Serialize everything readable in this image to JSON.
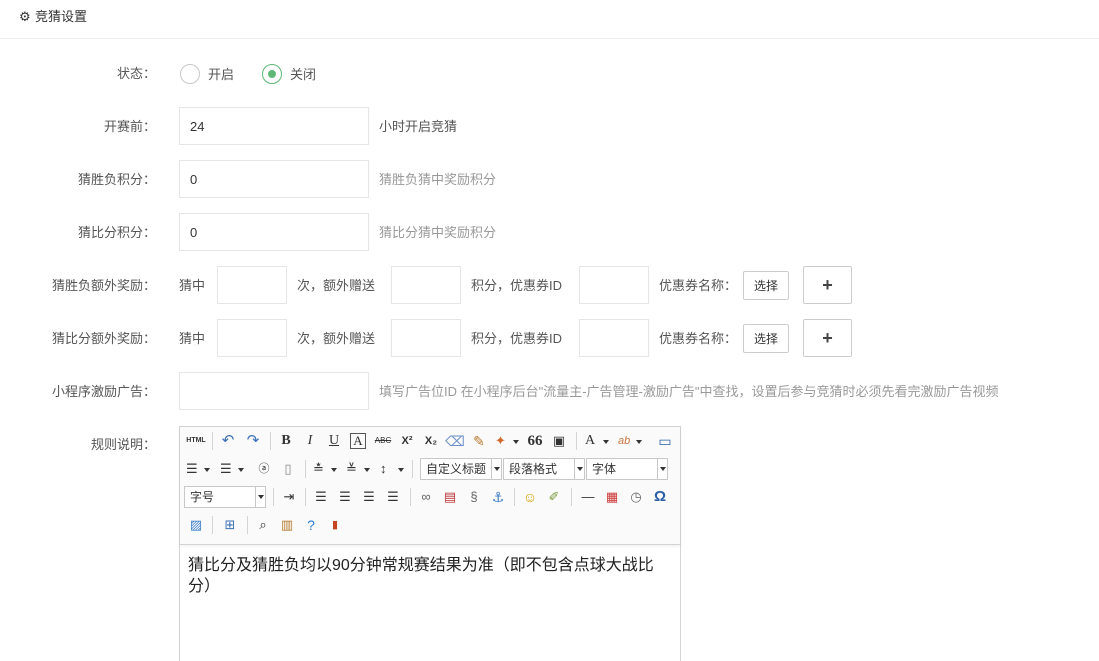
{
  "header": {
    "title": "竞猜设置",
    "icon": "gear-icon"
  },
  "status": {
    "label": "状态：",
    "options": [
      "开启",
      "关闭"
    ],
    "selected": "关闭",
    "accent": "#5fb878"
  },
  "before_match": {
    "label": "开赛前：",
    "value": "24",
    "suffix": "小时开启竞猜"
  },
  "win_lose_points": {
    "label": "猜胜负积分：",
    "value": "0",
    "hint": "猜胜负猜中奖励积分"
  },
  "score_points": {
    "label": "猜比分积分：",
    "value": "0",
    "hint": "猜比分猜中奖励积分"
  },
  "win_lose_extra": {
    "label": "猜胜负额外奖励：",
    "t_hit": "猜中",
    "times_value": "",
    "t_times": "次，额外赠送",
    "points_value": "",
    "t_points": "积分，优惠券ID",
    "coupon_value": "",
    "t_coupon_name": "优惠券名称：",
    "select_label": "选择",
    "add_label": "+"
  },
  "score_extra": {
    "label": "猜比分额外奖励：",
    "t_hit": "猜中",
    "times_value": "",
    "t_times": "次，额外赠送",
    "points_value": "",
    "t_points": "积分，优惠券ID",
    "coupon_value": "",
    "t_coupon_name": "优惠券名称：",
    "select_label": "选择",
    "add_label": "+"
  },
  "mini_ad": {
    "label": "小程序激励广告：",
    "value": "",
    "hint": "填写广告位ID 在小程序后台\"流量主-广告管理-激励广告\"中查找，设置后参与竞猜时必须先看完激励广告视频"
  },
  "rules": {
    "label": "规则说明：",
    "toolbar": {
      "html": "HTML",
      "bold": "B",
      "italic": "I",
      "underline": "U",
      "border": "A",
      "strike": "ABC",
      "sup": "X²",
      "sub": "X₂",
      "quote": "66",
      "font_color": "A",
      "highlight": "ab",
      "custom_title": "自定义标题",
      "paragraph": "段落格式",
      "font_family": "字体",
      "font_size": "字号",
      "special_char": "Ω"
    },
    "content": "猜比分及猜胜负均以90分钟常规赛结果为准（即不包含点球大战比分）"
  }
}
